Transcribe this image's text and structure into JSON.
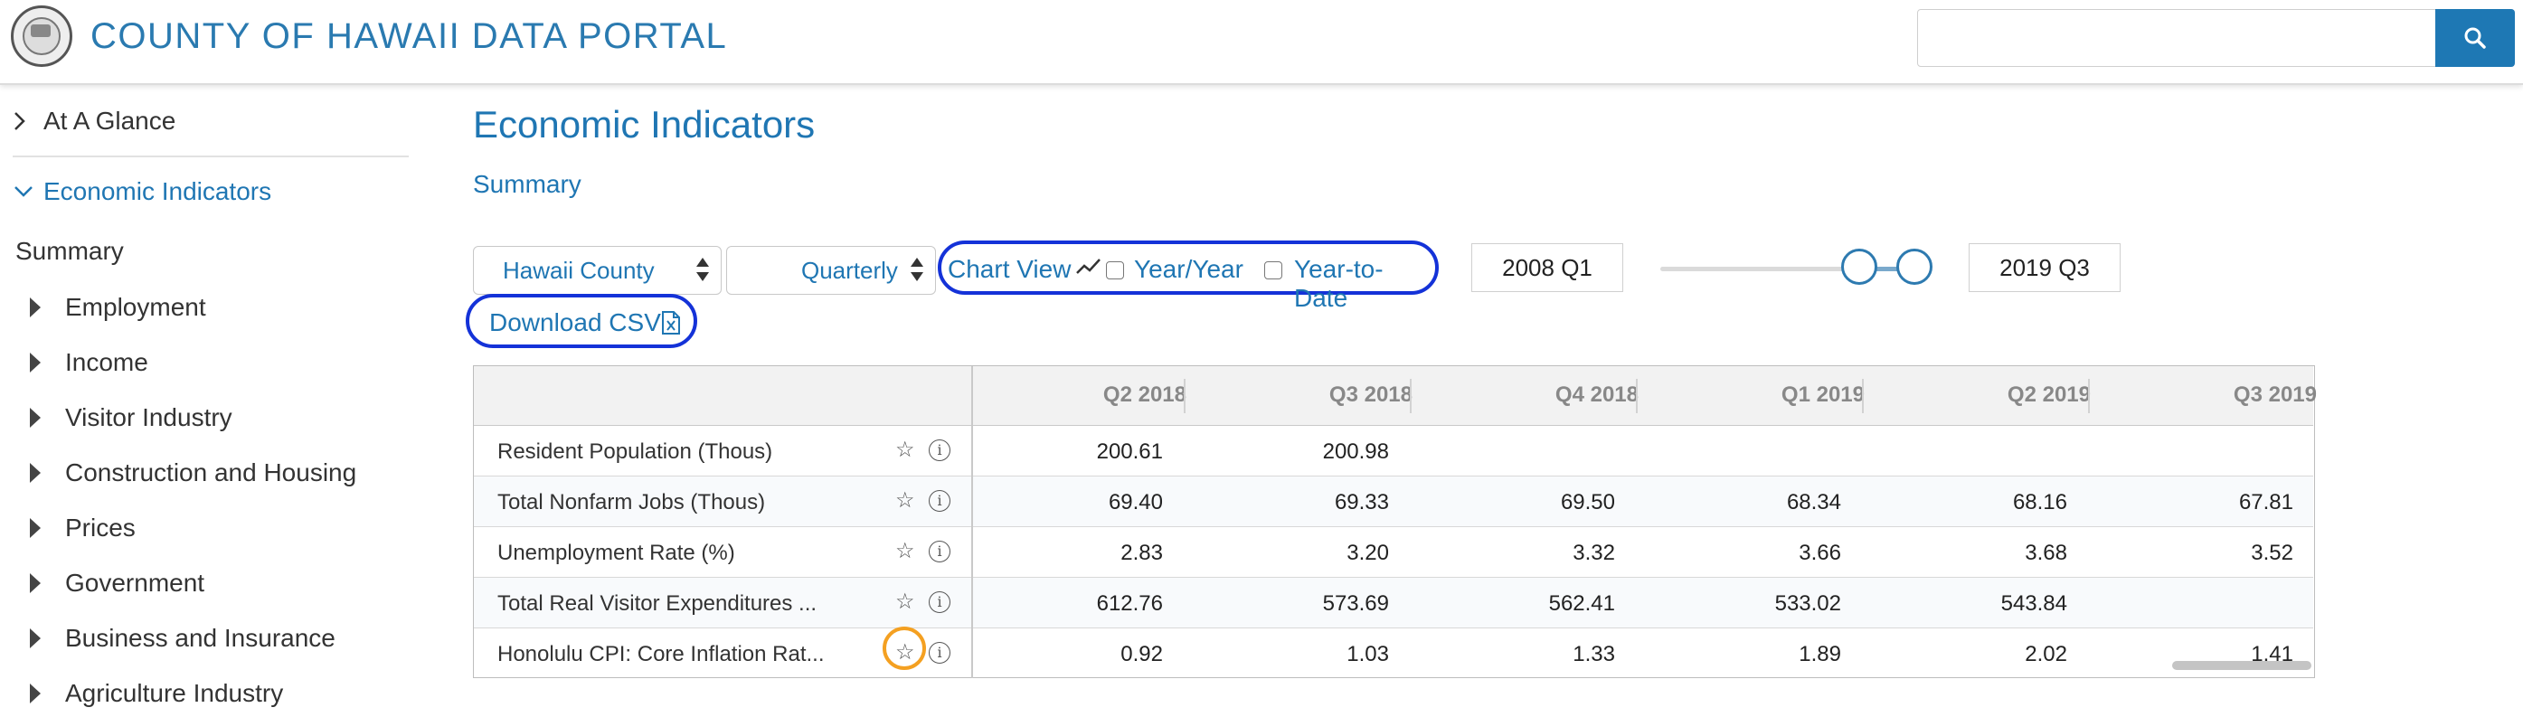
{
  "header": {
    "title": "COUNTY OF HAWAII DATA PORTAL",
    "search_placeholder": "",
    "search_icon": "search-icon",
    "accent_color": "#1e78b4"
  },
  "sidebar": {
    "at_a_glance": "At A Glance",
    "economic_indicators": "Economic Indicators",
    "summary": "Summary",
    "items": [
      {
        "label": "Employment"
      },
      {
        "label": "Income"
      },
      {
        "label": "Visitor Industry"
      },
      {
        "label": "Construction and Housing"
      },
      {
        "label": "Prices"
      },
      {
        "label": "Government"
      },
      {
        "label": "Business and Insurance"
      },
      {
        "label": "Agriculture Industry"
      }
    ]
  },
  "main": {
    "title": "Economic Indicators",
    "subtitle": "Summary",
    "controls": {
      "geography_select": "Hawaii County",
      "frequency_select": "Quarterly",
      "chart_view_label": "Chart View",
      "year_year_label": "Year/Year",
      "ytd_label": "Year-to-Date",
      "year_year_checked": false,
      "ytd_checked": false,
      "start_date": "2008 Q1",
      "end_date": "2019 Q3",
      "download_label": "Download CSV"
    },
    "table": {
      "columns": [
        "Q2 2018",
        "Q3 2018",
        "Q4 2018",
        "Q1 2019",
        "Q2 2019",
        "Q3 2019"
      ],
      "rows": [
        {
          "label": "Resident Population (Thous)",
          "values": [
            "200.61",
            "200.98",
            "",
            "",
            "",
            ""
          ]
        },
        {
          "label": "Total Nonfarm Jobs (Thous)",
          "values": [
            "69.40",
            "69.33",
            "69.50",
            "68.34",
            "68.16",
            "67.81"
          ]
        },
        {
          "label": "Unemployment Rate (%)",
          "values": [
            "2.83",
            "3.20",
            "3.32",
            "3.66",
            "3.68",
            "3.52"
          ]
        },
        {
          "label": "Total Real Visitor Expenditures ...",
          "values": [
            "612.76",
            "573.69",
            "562.41",
            "533.02",
            "543.84",
            ""
          ]
        },
        {
          "label": "Honolulu CPI: Core Inflation Rat...",
          "values": [
            "0.92",
            "1.03",
            "1.33",
            "1.89",
            "2.02",
            "1.41"
          ]
        }
      ]
    }
  }
}
